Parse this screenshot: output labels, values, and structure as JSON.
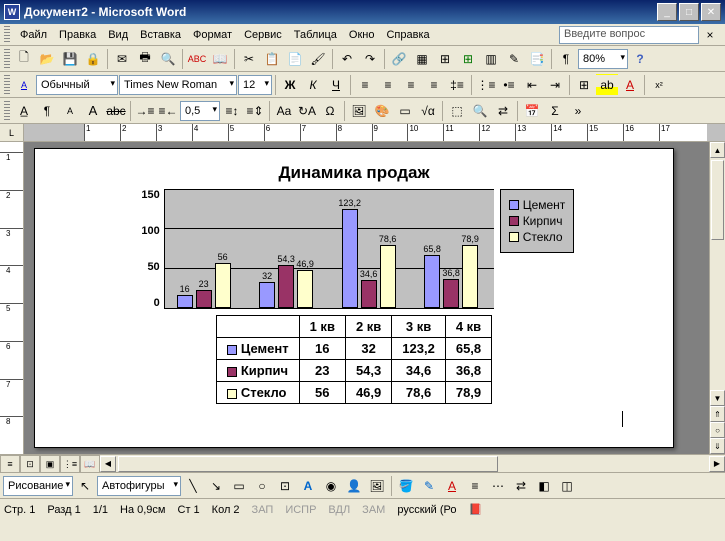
{
  "window": {
    "title": "Документ2 - Microsoft Word"
  },
  "menus": [
    "Файл",
    "Правка",
    "Вид",
    "Вставка",
    "Формат",
    "Сервис",
    "Таблица",
    "Окно",
    "Справка"
  ],
  "question_placeholder": "Введите вопрос",
  "formatting": {
    "style": "Обычный",
    "font": "Times New Roman",
    "size": "12",
    "zoom": "80%",
    "list_indent": "0,5"
  },
  "drawing": {
    "label": "Рисование",
    "autoshapes": "Автофигуры"
  },
  "status": {
    "page": "Стр. 1",
    "section": "Разд 1",
    "pages": "1/1",
    "at": "На 0,9см",
    "line": "Ст 1",
    "col": "Кол 2",
    "rec": "ЗАП",
    "trk": "ИСПР",
    "ext": "ВДЛ",
    "ovr": "ЗАМ",
    "lang": "русский (Ро"
  },
  "chart_data": {
    "type": "bar",
    "title": "Динамика продаж",
    "categories": [
      "1 кв",
      "2 кв",
      "3 кв",
      "4 кв"
    ],
    "series": [
      {
        "name": "Цемент",
        "values": [
          16,
          32,
          123.2,
          65.8
        ],
        "color": "#9999ff"
      },
      {
        "name": "Кирпич",
        "values": [
          23,
          54.3,
          34.6,
          36.8
        ],
        "color": "#993366"
      },
      {
        "name": "Стекло",
        "values": [
          56,
          46.9,
          78.6,
          78.9
        ],
        "color": "#ffffcc"
      }
    ],
    "y_ticks": [
      0,
      50,
      100,
      150
    ],
    "ylim": [
      0,
      150
    ],
    "display_labels": [
      [
        "16",
        "23",
        "56"
      ],
      [
        "32",
        "54,3",
        "46,9"
      ],
      [
        "123,2",
        "34,6",
        "78,6"
      ],
      [
        "65,8",
        "36,8",
        "78,9"
      ]
    ]
  },
  "ruler_h": [
    "1",
    "2",
    "3",
    "4",
    "5",
    "6",
    "7",
    "8",
    "9",
    "10",
    "11",
    "12",
    "13",
    "14",
    "15",
    "16",
    "17"
  ],
  "ruler_v": [
    "1",
    "2",
    "3",
    "4",
    "5",
    "6",
    "7",
    "8"
  ]
}
